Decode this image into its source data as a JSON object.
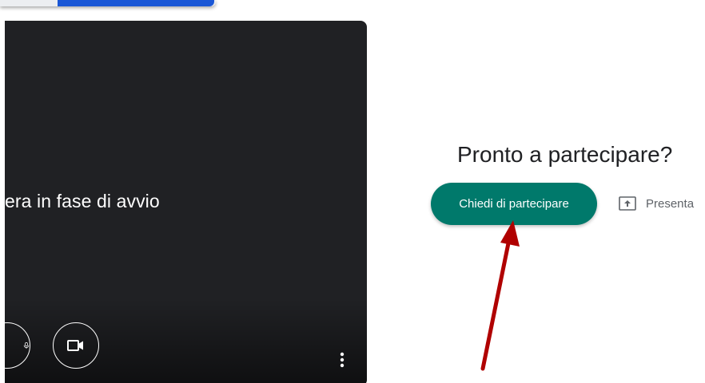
{
  "preview": {
    "status_text": "era in fase di avvio",
    "mic_icon": "mic-icon",
    "camera_icon": "videocam-icon",
    "more_icon": "more-vert-icon"
  },
  "join_panel": {
    "title": "Pronto a partecipare?",
    "join_label": "Chiedi di partecipare",
    "present_label": "Presenta",
    "present_icon": "present-screen-icon"
  },
  "colors": {
    "join_button": "#00796b",
    "preview_background": "#202124",
    "annotation_arrow": "#b00000"
  }
}
